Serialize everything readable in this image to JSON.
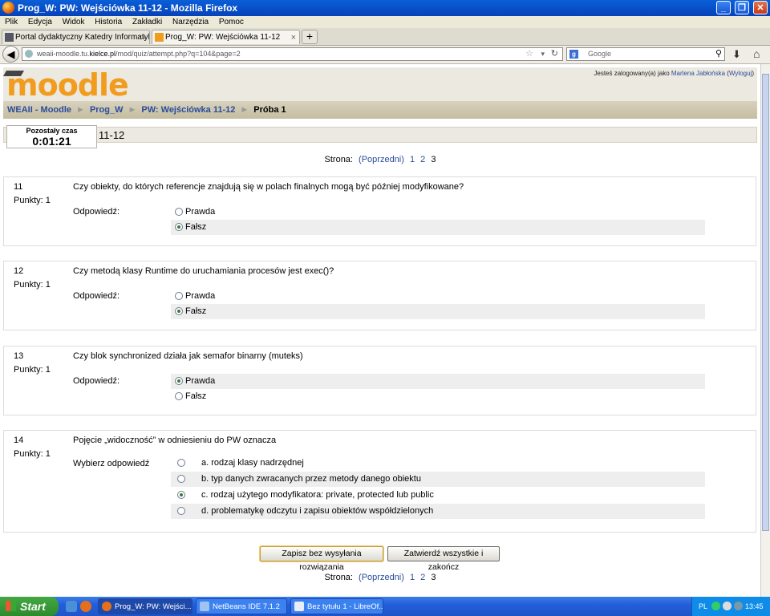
{
  "window": {
    "title": "Prog_W: PW: Wejściówka 11-12 - Mozilla Firefox",
    "buttons": [
      "_",
      "❐",
      "✕"
    ]
  },
  "menu": [
    "Plik",
    "Edycja",
    "Widok",
    "Historia",
    "Zakładki",
    "Narzędzia",
    "Pomoc"
  ],
  "tabs": [
    {
      "label": "Portal dydaktyczny Katedry Informatyki ...",
      "close": "×"
    },
    {
      "label": "Prog_W: PW: Wejściówka 11-12",
      "close": "×"
    }
  ],
  "newtab": "+",
  "nav": {
    "url_prefix": "weaii-moodle.tu.",
    "url_domain": "kielce.pl",
    "url_suffix": "/mod/quiz/attempt.php?q=104&page=2",
    "search_placeholder": "Google",
    "search_engine_letter": "g"
  },
  "header": {
    "logo": "moodle",
    "login_prefix": "Jesteś zalogowany(a) jako",
    "user": "Marlena Jabłońska",
    "logout": "Wyloguj"
  },
  "breadcrumb": [
    "WEAII - Moodle",
    "Prog_W",
    "PW: Wejściówka 11-12",
    "Próba 1"
  ],
  "quiz": {
    "title_visible": "11-12",
    "timer_label": "Pozostały czas",
    "timer_value": "0:01:21"
  },
  "pager": {
    "label": "Strona:",
    "prev": "(Poprzedni)",
    "pages": [
      "1",
      "2"
    ],
    "current": "3"
  },
  "questions": [
    {
      "num": "11",
      "points": "Punkty: 1",
      "text": "Czy obiekty, do których referencje znajdują się w polach finalnych mogą być później modyfikowane?",
      "answer_label": "Odpowiedź:",
      "options": [
        {
          "label": "Prawda",
          "selected": false
        },
        {
          "label": "Fałsz",
          "selected": true
        }
      ]
    },
    {
      "num": "12",
      "points": "Punkty: 1",
      "text": "Czy metodą klasy Runtime do uruchamiania procesów jest exec()?",
      "answer_label": "Odpowiedź:",
      "options": [
        {
          "label": "Prawda",
          "selected": false
        },
        {
          "label": "Fałsz",
          "selected": true
        }
      ]
    },
    {
      "num": "13",
      "points": "Punkty: 1",
      "text": "Czy blok synchronized działa jak semafor binarny (muteks)",
      "answer_label": "Odpowiedź:",
      "options": [
        {
          "label": "Prawda",
          "selected": true
        },
        {
          "label": "Fałsz",
          "selected": false
        }
      ]
    },
    {
      "num": "14",
      "points": "Punkty: 1",
      "text": "Pojęcie „widoczność” w odniesieniu do PW oznacza",
      "answer_label": "Wybierz odpowiedź",
      "options": [
        {
          "label": "a. rodzaj klasy nadrzędnej",
          "selected": false
        },
        {
          "label": "b. typ danych zwracanych przez metody danego obiektu",
          "selected": false
        },
        {
          "label": "c. rodzaj użytego modyfikatora: private, protected lub public",
          "selected": true
        },
        {
          "label": "d. problematykę odczytu i zapisu obiektów współdzielonych",
          "selected": false
        }
      ]
    }
  ],
  "buttons": {
    "save": "Zapisz bez wysyłania rozwiązania",
    "submit": "Zatwierdź wszystkie i zakończ"
  },
  "taskbar": {
    "start": "Start",
    "tasks": [
      "Prog_W: PW: Wejści...",
      "NetBeans IDE 7.1.2",
      "Bez tytułu 1 - LibreOf..."
    ],
    "lang": "PL",
    "clock": "13:45"
  },
  "colors": {
    "link": "#2a4b9b",
    "logo": "#f29c1f",
    "titlebar": "#0a5fd8",
    "selected_radio": "#3a7a3a"
  }
}
